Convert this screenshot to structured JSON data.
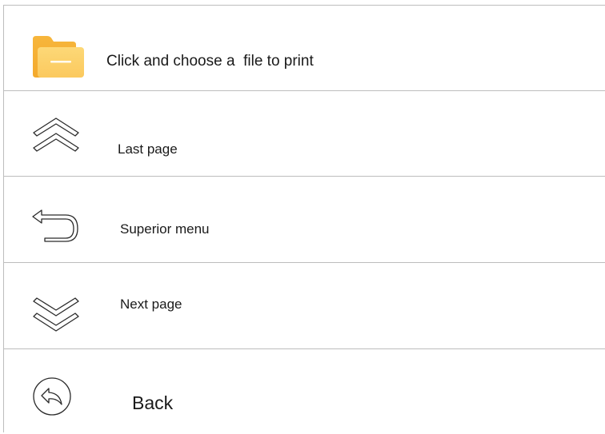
{
  "menu": {
    "items": [
      {
        "label": "Click and choose a  file to print",
        "icon": "folder-icon"
      },
      {
        "label": "Last page",
        "icon": "double-chevron-up-icon"
      },
      {
        "label": "Superior menu",
        "icon": "return-arrow-icon"
      },
      {
        "label": "Next page",
        "icon": "double-chevron-down-icon"
      },
      {
        "label": "Back",
        "icon": "back-circle-icon"
      }
    ]
  },
  "colors": {
    "folder_accent": "#f9c04f",
    "divider": "#bdbdbd",
    "icon_stroke": "#2a2a2a"
  }
}
